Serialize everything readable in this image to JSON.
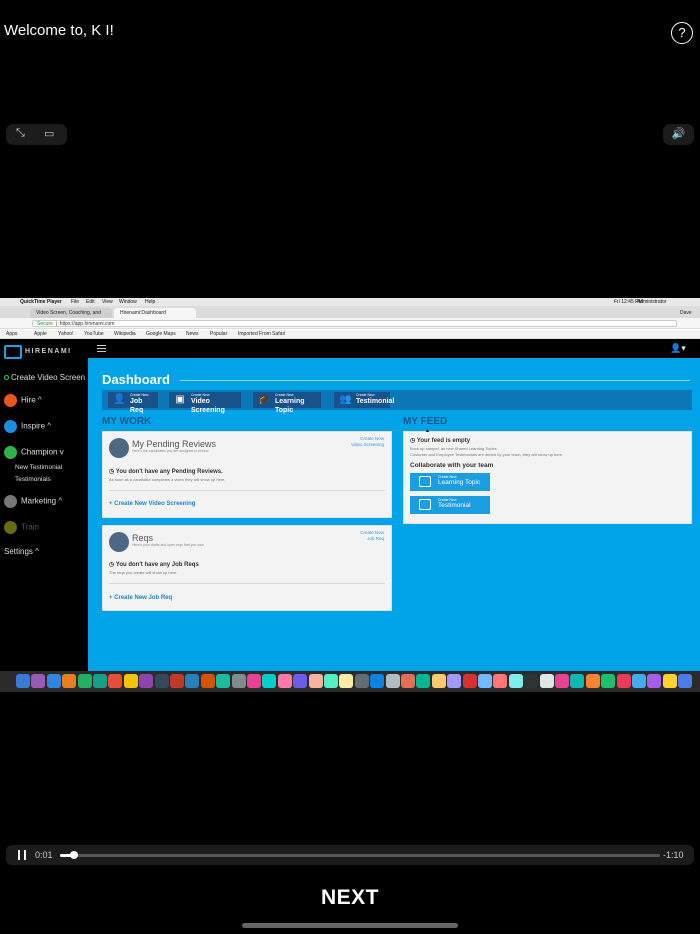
{
  "header": {
    "welcome": "Welcome to, K I!",
    "help_icon": "?"
  },
  "controls": {
    "expand_icon": "⤡",
    "pip_icon": "▭",
    "volume_icon": "🔊"
  },
  "mac_menubar": {
    "apple": "",
    "app": "QuickTime Player",
    "items": [
      "File",
      "Edit",
      "View",
      "Window",
      "Help"
    ],
    "clock": "Fri 12:45 PM",
    "user": "Administrator"
  },
  "browser": {
    "tabs": [
      "Video Screen, Coaching, and",
      "Hirenami:Dashboard"
    ],
    "profile": "Dave",
    "secure": "Secure",
    "url": "https://app.hirenami.com",
    "bookmarks": [
      "Apps",
      "Apple",
      "Yahoo!",
      "YouTube",
      "Wikipedia",
      "Google Maps",
      "News",
      "Popular",
      "Imported From Safari"
    ]
  },
  "app": {
    "logo": "HIRENAMI",
    "sidebar": [
      {
        "label": "Create Video Screen",
        "color": "#2ecc40"
      },
      {
        "label": "Hire ^",
        "color": "#e8561d"
      },
      {
        "label": "Inspire ^",
        "color": "#1d8ee0"
      },
      {
        "label": "Champion v",
        "color": "#2db34a"
      },
      {
        "label": "New Testimonial"
      },
      {
        "label": "Testimonials"
      },
      {
        "label": "Marketing ^",
        "color": "#777"
      },
      {
        "label": "Train",
        "color": "#6b6a14"
      },
      {
        "label": "Settings ^"
      }
    ],
    "dashboard_title": "Dashboard",
    "quick_create": [
      {
        "small": "Create New",
        "label": "Job Req"
      },
      {
        "small": "Create New",
        "label": "Video Screening"
      },
      {
        "small": "Create New",
        "label": "Learning Topic"
      },
      {
        "small": "Create New",
        "label": "Testimonial"
      }
    ],
    "my_work": "MY WORK",
    "my_feed": "MY FEED",
    "pending": {
      "title": "My Pending Reviews",
      "subtitle": "Here's the candidates you are assigned to review.",
      "create_small": "Create New",
      "create_label": "Video Screening",
      "empty_title": "You don't have any Pending Reviews.",
      "empty_sub": "As soon as a candidate completes a video they will show up here.",
      "link": "+ Create New Video Screening"
    },
    "reqs": {
      "title": "Reqs",
      "subtitle": "Here's your drafts and open reqs that you own",
      "create_small": "Create New",
      "create_label": "Job Req",
      "empty_title": "You don't have any Job Reqs",
      "empty_sub": "The reqs you create will show up here.",
      "link": "+ Create New Job Req"
    },
    "feed": {
      "empty_title": "Your feed is empty",
      "empty_sub1": "Buck up camper, as new Shared Learning Topics,",
      "empty_sub2": "Customer and Employee Testimonials are added by your team, they will show up here.",
      "collab": "Collaborate with your team",
      "btn1_small": "Create New",
      "btn1_label": "Learning Topic",
      "btn2_small": "Create New",
      "btn2_label": "Testimonial"
    }
  },
  "playback": {
    "current": "0:01",
    "remaining": "-1:10",
    "progress": 0.02
  },
  "next_label": "NEXT"
}
